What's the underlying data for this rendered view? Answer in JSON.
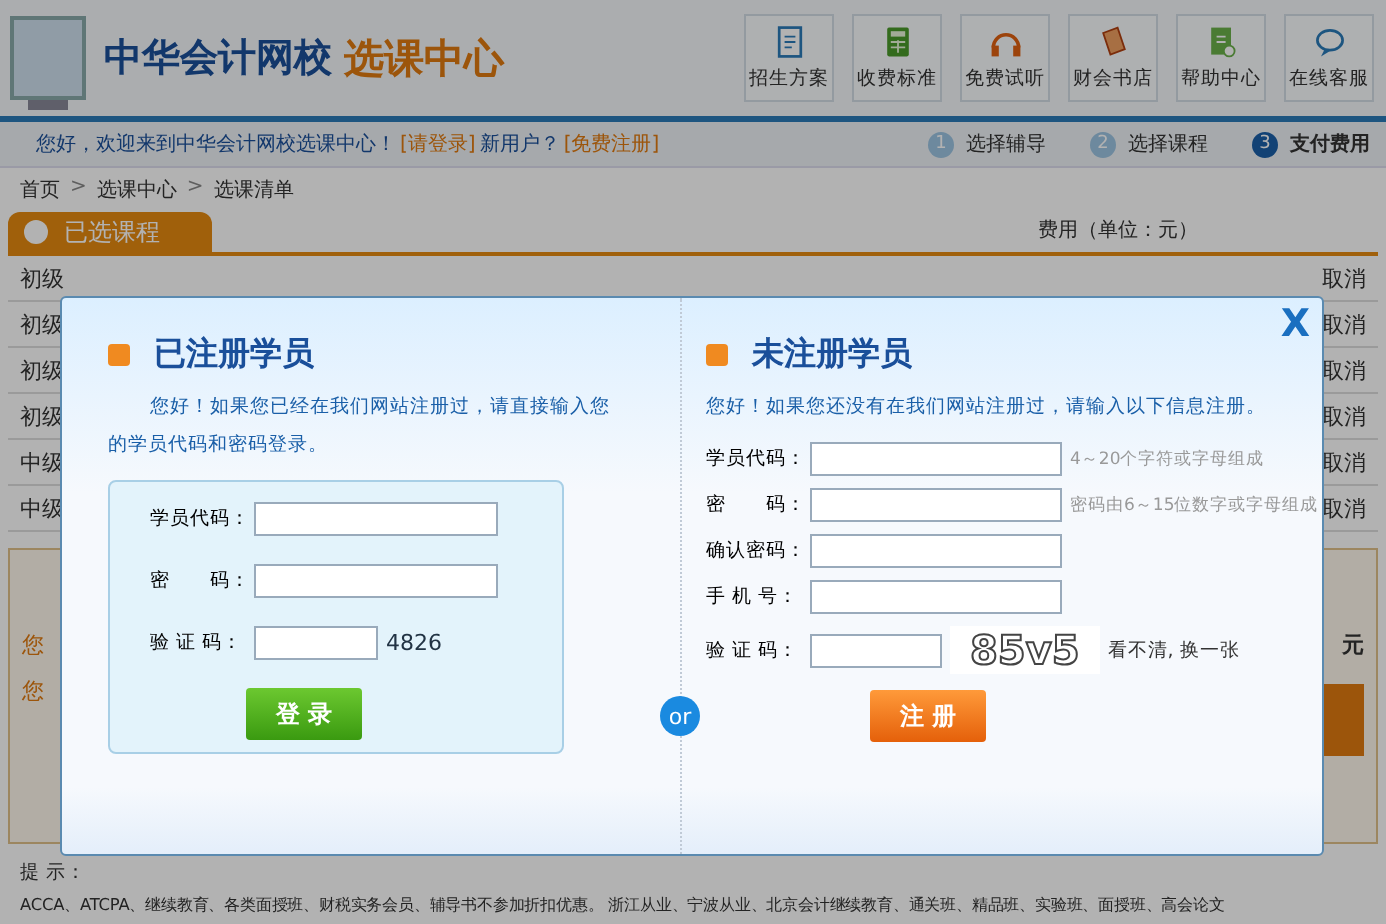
{
  "header": {
    "brand": "中华会计网校",
    "title": "选课中心",
    "nav": [
      {
        "label": "招生方案"
      },
      {
        "label": "收费标准"
      },
      {
        "label": "免费试听"
      },
      {
        "label": "财会书店"
      },
      {
        "label": "帮助中心"
      },
      {
        "label": "在线客服"
      }
    ]
  },
  "welcome": {
    "text": "您好，欢迎来到中华会计网校选课中心！",
    "login": "[请登录]",
    "new_user": "新用户？",
    "register": "[免费注册]"
  },
  "steps": [
    {
      "number": "1",
      "label": "选择辅导",
      "selected": false
    },
    {
      "number": "2",
      "label": "选择课程",
      "selected": false
    },
    {
      "number": "3",
      "label": "支付费用",
      "selected": true
    }
  ],
  "breadcrumb": {
    "items": [
      "首页",
      "选课中心",
      "选课清单"
    ],
    "separator": ">"
  },
  "course_tab": {
    "label": "已选课程",
    "fee_label": "费用（单位：元）"
  },
  "rows": [
    {
      "name": "初级",
      "action": "取消"
    },
    {
      "name": "初级",
      "action": "取消"
    },
    {
      "name": "初级",
      "action": "取消"
    },
    {
      "name": "初级",
      "action": "取消"
    },
    {
      "name": "中级",
      "action": "取消"
    },
    {
      "name": "中级",
      "action": "取消"
    }
  ],
  "summary": {
    "lines": [
      "您",
      "您"
    ],
    "unit": "元"
  },
  "tips": {
    "title": "提 示：",
    "text": "ACCA、ATCPA、继续教育、各类面授班、财税实务会员、辅导书不参加折扣优惠。 浙江从业、宁波从业、北京会计继续教育、通关班、精品班、实验班、面授班、高会论文"
  },
  "modal": {
    "close": "X",
    "separator": "or",
    "registered": {
      "title": "已注册学员",
      "intro": "您好！如果您已经在我们网站注册过，请直接输入您的学员代码和密码登录。",
      "fields": [
        {
          "label": "学员代码：",
          "kind": "text"
        },
        {
          "label": "密　　码：",
          "kind": "text"
        },
        {
          "label": "验 证 码：",
          "kind": "captcha",
          "captcha": "4826"
        }
      ],
      "button": "登 录"
    },
    "unregistered": {
      "title": "未注册学员",
      "intro": "您好！如果您还没有在我们网站注册过，请输入以下信息注册。",
      "fields": [
        {
          "label": "学员代码：",
          "kind": "text",
          "hint": "4～20个字符或字母组成"
        },
        {
          "label": "密　　码：",
          "kind": "text",
          "hint": "密码由6～15位数字或字母组成"
        },
        {
          "label": "确认密码：",
          "kind": "text"
        },
        {
          "label": "手 机 号：",
          "kind": "text"
        },
        {
          "label": "验 证 码：",
          "kind": "captcha",
          "captcha": "85v5",
          "refresh": "看不清, 换一张"
        }
      ],
      "button": "注 册"
    }
  }
}
